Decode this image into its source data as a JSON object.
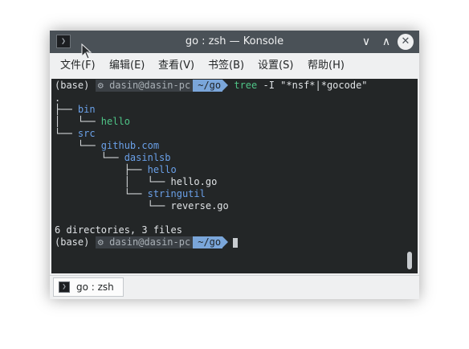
{
  "window": {
    "title": "go : zsh — Konsole",
    "app_icon_glyph": "❯",
    "minimize_glyph": "∨",
    "maximize_glyph": "∧",
    "close_glyph": "✕"
  },
  "menu": {
    "items": [
      "文件(F)",
      "编辑(E)",
      "查看(V)",
      "书签(B)",
      "设置(S)",
      "帮助(H)"
    ]
  },
  "terminal": {
    "prompt1": {
      "env": "(base)",
      "gear": "⚙",
      "user_host": "dasin@dasin-pc",
      "dir": "~/go",
      "cmd_name": "tree",
      "cmd_args": " -I \"*nsf*|*gocode\""
    },
    "tree": {
      "root": ".",
      "lines": [
        {
          "prefix": "├── ",
          "name": "bin",
          "kind": "dir"
        },
        {
          "prefix": "│   └── ",
          "name": "hello",
          "kind": "exec"
        },
        {
          "prefix": "└── ",
          "name": "src",
          "kind": "dir"
        },
        {
          "prefix": "    └── ",
          "name": "github.com",
          "kind": "dir"
        },
        {
          "prefix": "        └── ",
          "name": "dasinlsb",
          "kind": "dir"
        },
        {
          "prefix": "            ├── ",
          "name": "hello",
          "kind": "dir"
        },
        {
          "prefix": "            │   └── ",
          "name": "hello.go",
          "kind": "file"
        },
        {
          "prefix": "            └── ",
          "name": "stringutil",
          "kind": "dir"
        },
        {
          "prefix": "                └── ",
          "name": "reverse.go",
          "kind": "file"
        }
      ],
      "summary": "6 directories, 3 files"
    },
    "prompt2": {
      "env": "(base)",
      "gear": "⚙",
      "user_host": "dasin@dasin-pc",
      "dir": "~/go"
    }
  },
  "tabs": [
    {
      "label": "go : zsh",
      "icon_glyph": "❯"
    }
  ],
  "colors": {
    "titlebar": "#4a5157",
    "terminal_bg": "#232627",
    "dir_blue": "#6aa0e8",
    "exec_green": "#4fc487",
    "prompt_dir_bg": "#7aa6da"
  }
}
